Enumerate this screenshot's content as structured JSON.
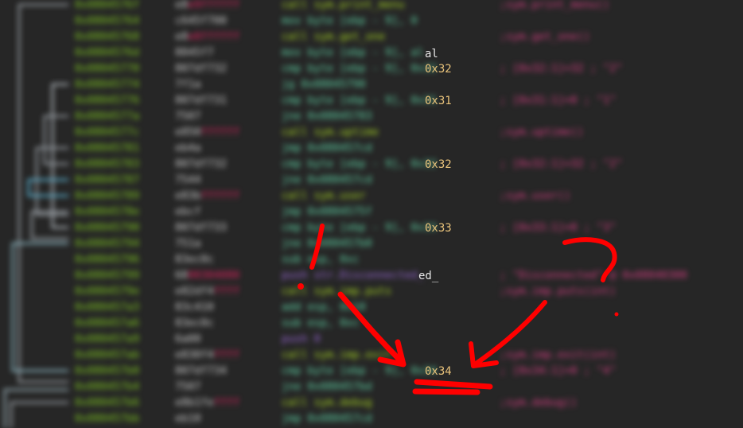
{
  "rows": [
    {
      "addr": "0x0804576f",
      "bytes": "e8",
      "bytes_tail": "e9ffffff",
      "instr": "call sym.print_menu",
      "kind": "call",
      "comment": ";sym.print_menu()"
    },
    {
      "addr": "0x08045764",
      "bytes": "c645f700",
      "bytes_tail": "",
      "instr": "mov byte [ebp - 9], 0",
      "kind": "op",
      "comment": ""
    },
    {
      "addr": "0x08045768",
      "bytes": "e8",
      "bytes_tail": "e0ffffff",
      "instr": "call sym.get_one",
      "kind": "call",
      "comment": ";sym.get_one()"
    },
    {
      "addr": "0x0804576d",
      "bytes": "8845f7",
      "bytes_tail": "",
      "instr": "mov byte [ebp - 9], al",
      "kind": "op",
      "comment": ""
    },
    {
      "addr": "0x08045770",
      "bytes": "807df732",
      "bytes_tail": "",
      "instr": "cmp byte [ebp - 9], 0x32",
      "kind": "op",
      "comment": "; [0x32:1]=32 ; \"2\""
    },
    {
      "addr": "0x08045774",
      "bytes": "7f1a",
      "bytes_tail": "",
      "instr": "jg 0x08045790",
      "kind": "op",
      "comment": ""
    },
    {
      "addr": "0x08045776",
      "bytes": "807df731",
      "bytes_tail": "",
      "instr": "cmp byte [ebp - 9], 0x31",
      "kind": "op",
      "comment": "; [0x31:1]=0 ; \"1\""
    },
    {
      "addr": "0x0804577a",
      "bytes": "7507",
      "bytes_tail": "",
      "instr": "jne 0x08045783",
      "kind": "op",
      "comment": ""
    },
    {
      "addr": "0x0804577c",
      "bytes": "e850",
      "bytes_tail": "ffffff",
      "instr": "call sym.uptime",
      "kind": "call",
      "comment": ";sym.uptime()"
    },
    {
      "addr": "0x08045781",
      "bytes": "eb4a",
      "bytes_tail": "",
      "instr": "jmp 0x080457cd",
      "kind": "op",
      "comment": ""
    },
    {
      "addr": "0x08045783",
      "bytes": "807df732",
      "bytes_tail": "",
      "instr": "cmp byte [ebp - 9], 0x32",
      "kind": "op",
      "comment": "; [0x32:1]=32 ; \"2\""
    },
    {
      "addr": "0x08045787",
      "bytes": "7544",
      "bytes_tail": "",
      "instr": "jne 0x080457cd",
      "kind": "op",
      "comment": ""
    },
    {
      "addr": "0x08045789",
      "bytes": "e83b",
      "bytes_tail": "ffffff",
      "instr": "call sym.user",
      "kind": "call",
      "comment": ";sym.user()"
    },
    {
      "addr": "0x0804578e",
      "bytes": "ebcf",
      "bytes_tail": "",
      "instr": "jmp 0x0804575f",
      "kind": "op",
      "comment": ""
    },
    {
      "addr": "0x08045790",
      "bytes": "807df733",
      "bytes_tail": "",
      "instr": "cmp byte [ebp - 9], 0x33",
      "kind": "op",
      "comment": "; [0x33:1]=0 ; \"3\""
    },
    {
      "addr": "0x08045794",
      "bytes": "751a",
      "bytes_tail": "",
      "instr": "jne 0x080457b0",
      "kind": "op",
      "comment": ""
    },
    {
      "addr": "0x08045796",
      "bytes": "83ec0c",
      "bytes_tail": "",
      "instr": "sub esp, 0xc",
      "kind": "op",
      "comment": ""
    },
    {
      "addr": "0x08045799",
      "bytes": "68",
      "bytes_tail": "00304080",
      "instr": "push str.Disconnected_",
      "kind": "push",
      "comment": "; \"Disconnected\" @ 0x08040300"
    },
    {
      "addr": "0x0804579e",
      "bytes": "e82df4",
      "bytes_tail": "ffff",
      "instr": "call sym.imp.puts",
      "kind": "call",
      "comment": ";sym.imp.puts(int)"
    },
    {
      "addr": "0x080457a3",
      "bytes": "83c410",
      "bytes_tail": "",
      "instr": "add esp, 0x10",
      "kind": "op",
      "comment": ""
    },
    {
      "addr": "0x080457a6",
      "bytes": "83ec0c",
      "bytes_tail": "",
      "instr": "sub esp, 0xc",
      "kind": "op",
      "comment": ""
    },
    {
      "addr": "0x080457a9",
      "bytes": "6a00",
      "bytes_tail": "",
      "instr": "push 0",
      "kind": "push",
      "comment": ""
    },
    {
      "addr": "0x080457ab",
      "bytes": "e830f4",
      "bytes_tail": "ffff",
      "instr": "call sym.imp.exit",
      "kind": "call",
      "comment": ";sym.imp.exit(int)"
    },
    {
      "addr": "0x080457b0",
      "bytes": "807df734",
      "bytes_tail": "",
      "instr": "cmp byte [ebp - 9], 0x34",
      "kind": "op",
      "comment": "; [0x34:1]=0 ; \"4\""
    },
    {
      "addr": "0x080457b4",
      "bytes": "7507",
      "bytes_tail": "",
      "instr": "jne 0x080457bd",
      "kind": "op",
      "comment": ""
    },
    {
      "addr": "0x080457b6",
      "bytes": "e8b1fe",
      "bytes_tail": "ffff",
      "instr": "call sym.debug",
      "kind": "call",
      "comment": ";sym.debug()"
    },
    {
      "addr": "0x080457bb",
      "bytes": "eb10",
      "bytes_tail": "",
      "instr": "jmp 0x080457cd",
      "kind": "op",
      "comment": ""
    }
  ],
  "visible": {
    "v1": "0x32",
    "v2": "0x31",
    "v3": "0x32",
    "v4": "0x33",
    "v5": "ed_",
    "v6": "0x34",
    "v7": "al"
  },
  "annotations": {
    "question_mark": "?"
  },
  "colors": {
    "background": "#262626",
    "address": "#7dc41f",
    "bytes": "#cfcfcf",
    "bytes_highlight": "#e0215f",
    "instruction": "#5fd3a5",
    "call": "#a8d824",
    "push": "#9a68d8",
    "comment": "#d53e82",
    "number": "#e8c27a",
    "annotation": "#ff0000"
  }
}
